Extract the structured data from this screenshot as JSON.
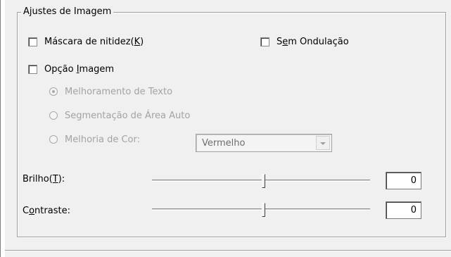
{
  "group": {
    "title": "Ajustes de Imagem"
  },
  "options": {
    "unsharp_mask": {
      "label_pre": "Máscara de nitidez(",
      "label_key": "K",
      "label_post": ")",
      "checked": false
    },
    "descreening": {
      "label_pre": "S",
      "label_key": "e",
      "label_post": "m Ondulação",
      "checked": false
    },
    "image_option": {
      "label_pre": "Opção ",
      "label_key": "I",
      "label_post": "magem",
      "checked": false
    }
  },
  "image_option_modes": {
    "selected": "Melhoramento de Texto",
    "items": [
      {
        "label": "Melhoramento de Texto",
        "selected": true
      },
      {
        "label": "Segmentação de Área Auto",
        "selected": false
      },
      {
        "label": "Melhoria de Cor:",
        "selected": false
      }
    ]
  },
  "color_select": {
    "value": "Vermelho"
  },
  "brightness": {
    "label_pre": "Brilho(",
    "label_key": "T",
    "label_post": "):",
    "value": "0",
    "level": 0.51
  },
  "contrast": {
    "label_pre": "C",
    "label_key": "o",
    "label_post": "ntraste:",
    "value": "0",
    "level": 0.51
  }
}
